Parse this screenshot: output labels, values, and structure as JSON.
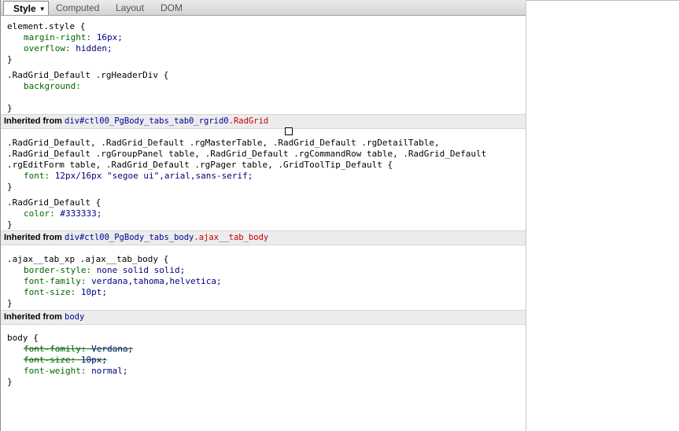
{
  "tabs": [
    {
      "label": "Style",
      "active": true
    },
    {
      "label": "Computed",
      "active": false
    },
    {
      "label": "Layout",
      "active": false
    },
    {
      "label": "DOM",
      "active": false
    }
  ],
  "rule1": {
    "selector": "element.style {",
    "decls": [
      {
        "prop": "margin-right:",
        "value": "16px;"
      },
      {
        "prop": "overflow:",
        "value": "hidden;"
      }
    ],
    "close": "}"
  },
  "rule2": {
    "selector": ".RadGrid_Default .rgHeaderDiv {",
    "decls": [
      {
        "prop": "background:",
        "value": ""
      }
    ],
    "close": "}"
  },
  "inherit1": {
    "label": "Inherited from",
    "tag": "div#ctl00_PgBody_tabs_tab0_rgrid0",
    "cls": ".RadGrid"
  },
  "rule3": {
    "selector_lines": [
      ".RadGrid_Default, .RadGrid_Default .rgMasterTable, .RadGrid_Default .rgDetailTable,",
      ".RadGrid_Default .rgGroupPanel table, .RadGrid_Default .rgCommandRow table, .RadGrid_Default",
      ".rgEditForm table, .RadGrid_Default .rgPager table, .GridToolTip_Default {"
    ],
    "decls": [
      {
        "prop": "font:",
        "value": "12px/16px \"segoe ui\",arial,sans-serif;"
      }
    ],
    "close": "}"
  },
  "rule4": {
    "selector": ".RadGrid_Default {",
    "decls": [
      {
        "prop": "color:",
        "value": "#333333;"
      }
    ],
    "close": "}"
  },
  "inherit2": {
    "label": "Inherited from",
    "tag": "div#ctl00_PgBody_tabs_body",
    "cls": ".ajax__tab_body"
  },
  "rule5": {
    "selector": ".ajax__tab_xp .ajax__tab_body {",
    "decls": [
      {
        "prop": "border-style:",
        "value": "none solid solid;"
      },
      {
        "prop": "font-family:",
        "value": "verdana,tahoma,helvetica;"
      },
      {
        "prop": "font-size:",
        "value": "10pt;"
      }
    ],
    "close": "}"
  },
  "inherit3": {
    "label": "Inherited from",
    "tag": "body"
  },
  "rule6": {
    "selector": "body {",
    "decls": [
      {
        "prop": "font-family:",
        "value": "Verdana;",
        "overridden": true
      },
      {
        "prop": "font-size:",
        "value": "10px;",
        "overridden": true
      },
      {
        "prop": "font-weight:",
        "value": "normal;",
        "overridden": false
      }
    ],
    "close": "}"
  }
}
